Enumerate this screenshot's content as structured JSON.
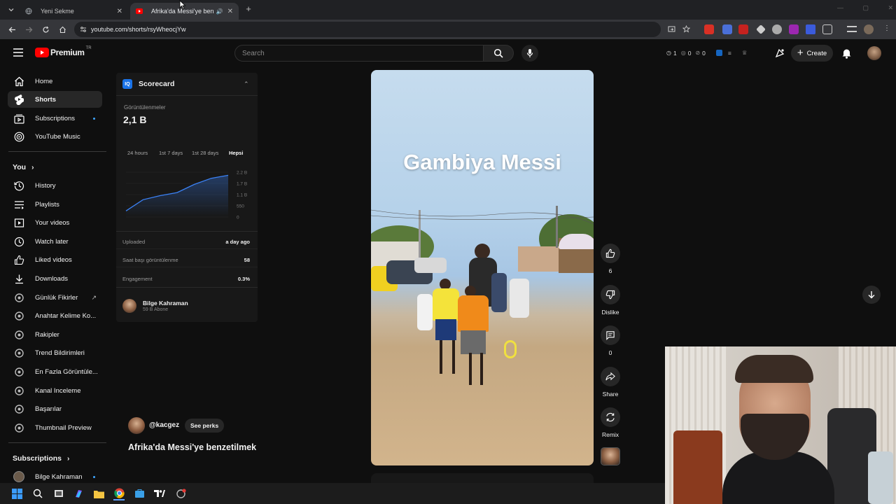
{
  "browser": {
    "tabs": [
      {
        "title": "Yeni Sekme",
        "active": false
      },
      {
        "title": "Afrika'da Messi'ye benzetilmek",
        "active": true
      }
    ],
    "url": "youtube.com/shorts/rsyWheocjYw"
  },
  "masthead": {
    "logo": "Premium",
    "region": "TR",
    "search_placeholder": "Search",
    "stats": {
      "a": "1",
      "b": "0",
      "c": "0"
    },
    "create_label": "Create"
  },
  "sidebar": {
    "main": [
      {
        "label": "Home",
        "icon": "home-icon"
      },
      {
        "label": "Shorts",
        "icon": "shorts-icon",
        "active": true
      },
      {
        "label": "Subscriptions",
        "icon": "subscriptions-icon"
      },
      {
        "label": "YouTube Music",
        "icon": "youtube-music-icon"
      }
    ],
    "you_heading": "You",
    "you": [
      {
        "label": "History",
        "icon": "history-icon"
      },
      {
        "label": "Playlists",
        "icon": "playlists-icon"
      },
      {
        "label": "Your videos",
        "icon": "your-videos-icon"
      },
      {
        "label": "Watch later",
        "icon": "watch-later-icon"
      },
      {
        "label": "Liked videos",
        "icon": "liked-videos-icon"
      },
      {
        "label": "Downloads",
        "icon": "downloads-icon"
      },
      {
        "label": "Günlük Fikirler",
        "icon": "extension-icon"
      },
      {
        "label": "Anahtar Kelime Ko...",
        "icon": "extension-icon"
      },
      {
        "label": "Rakipler",
        "icon": "extension-icon"
      },
      {
        "label": "Trend Bildirimleri",
        "icon": "extension-icon"
      },
      {
        "label": "En Fazla Görüntüle...",
        "icon": "extension-icon"
      },
      {
        "label": "Kanal Inceleme",
        "icon": "extension-icon"
      },
      {
        "label": "Başarılar",
        "icon": "extension-icon"
      },
      {
        "label": "Thumbnail Preview",
        "icon": "extension-icon"
      }
    ],
    "subscriptions_heading": "Subscriptions",
    "subscriptions": [
      {
        "label": "Bilge Kahraman"
      }
    ]
  },
  "scorecard": {
    "title": "Scorecard",
    "views_label": "Görüntülenmeler",
    "views_value": "2,1 B",
    "ranges": [
      "24 hours",
      "1st 7 days",
      "1st 28 days",
      "Hepsi"
    ],
    "active_range": "Hepsi",
    "y_ticks": [
      "2.2 B",
      "1.7 B",
      "1.1 B",
      "550",
      "0"
    ],
    "uploaded_label": "Uploaded",
    "uploaded_value": "a day ago",
    "hourly_label": "Saat başı görüntülenme",
    "hourly_value": "58",
    "engagement_label": "Engagement",
    "engagement_value": "0.3%",
    "channel_name": "Bilge Kahraman",
    "channel_subs": "59 B Abone"
  },
  "chart_data": {
    "type": "area",
    "x": [
      0,
      1,
      2,
      3,
      4,
      5,
      6
    ],
    "values": [
      0.3,
      0.85,
      1.05,
      1.2,
      1.6,
      1.9,
      2.05
    ],
    "ylim": [
      0,
      2.2
    ]
  },
  "video": {
    "overlay_title": "Gambiya Messi",
    "channel_handle": "@kacgez",
    "perks_label": "See perks",
    "title": "Afrika'da Messi'ye benzetilmek"
  },
  "actions": {
    "like_count": "6",
    "dislike_label": "Dislike",
    "comments_count": "0",
    "share_label": "Share",
    "remix_label": "Remix"
  },
  "colors": {
    "accent": "#3ea6ff",
    "brand_red": "#ff0000",
    "chart_line": "#3b82f6"
  }
}
